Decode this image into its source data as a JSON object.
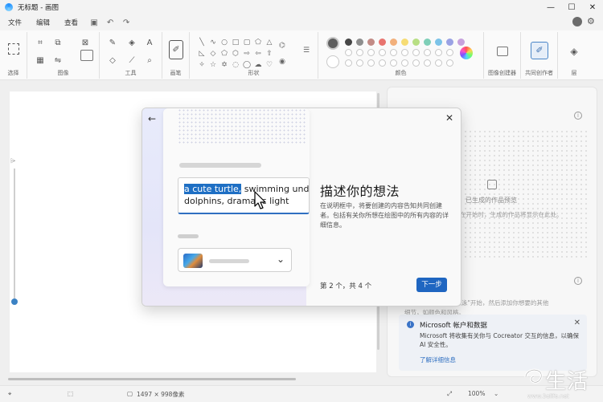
{
  "window": {
    "title": "无标题 - 画图",
    "minimize": "—",
    "maximize": "☐",
    "close": "✕"
  },
  "menu": {
    "items": [
      "文件",
      "编辑",
      "查看"
    ]
  },
  "ribbon": {
    "groups": {
      "select": "选择",
      "image": "图像",
      "tools": "工具",
      "brushes": "画笔",
      "shapes": "形状",
      "colors": "颜色",
      "image_creator": "图像创建器",
      "cocreator": "共同创作者",
      "layers": "层"
    },
    "colors": {
      "row1": [
        "#464646",
        "#8e8e8e",
        "#c28b86",
        "#e8746f",
        "#f2b07c",
        "#f6dc74",
        "#b8df84",
        "#7fcfb8",
        "#7cc3e8",
        "#9aa2e4",
        "#c7a2dd"
      ],
      "primary": "#5e5e5e",
      "secondary": "#ffffff"
    }
  },
  "right_panel": {
    "preview_label": "已生成的作品预览",
    "preview_sub": "在开始时，生成的作品将显示在此处。",
    "prompt_hint": "输入描述或从\"掷骰源泳\"开始，然后添加你想要的其他",
    "prompt_hint2": "细节，如颜色和风格。",
    "privacy_title": "Microsoft 帐户和数据",
    "privacy_body": "Microsoft 将收集有关你与 Cocreator 交互的信息，以确保 AI 安全性。",
    "privacy_link": "了解详细信息"
  },
  "status": {
    "canvas_size": "1497 × 998像素",
    "zoom": "100%"
  },
  "modal": {
    "title": "描述你的想法",
    "description": "在说明框中，将要创建的内容告知共同创建者。包括有关你所想在绘图中的所有内容的详细信息。",
    "step": "第 2 个，共 4 个",
    "next": "下一步",
    "prompt_highlight": "a cute turtle,",
    "prompt_rest": " swimming under the",
    "prompt_line2": "dolphins, dramatic light"
  },
  "watermark": {
    "text": "生活",
    "url": "www.3elife.net"
  }
}
